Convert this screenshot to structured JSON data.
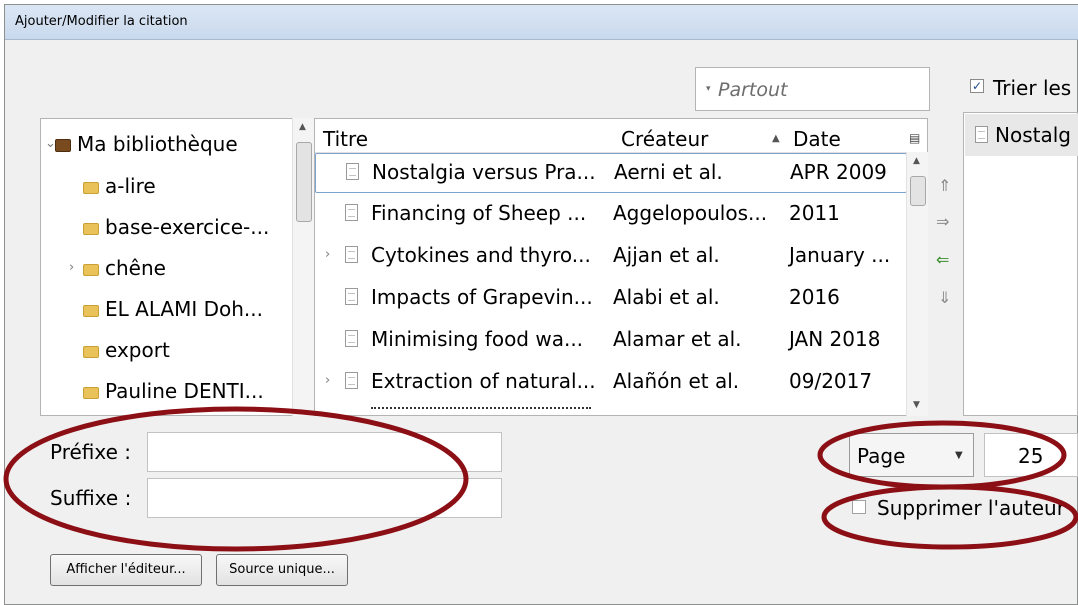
{
  "window": {
    "title": "Ajouter/Modifier la citation"
  },
  "search": {
    "placeholder": "Partout"
  },
  "sort": {
    "label": "Trier les",
    "checked": true,
    "check_glyph": "✓"
  },
  "collections": {
    "items": [
      {
        "label": "Ma bibliothèque",
        "expander": "⌄",
        "icon": "library-icon"
      },
      {
        "label": "a-lire",
        "icon": "folder-icon"
      },
      {
        "label": "base-exercice-...",
        "icon": "folder-icon"
      },
      {
        "label": "chêne",
        "expander": "›",
        "icon": "folder-icon"
      },
      {
        "label": "EL ALAMI Doh...",
        "icon": "folder-icon"
      },
      {
        "label": "export",
        "icon": "folder-icon"
      },
      {
        "label": "Pauline DENTI...",
        "icon": "folder-icon"
      }
    ]
  },
  "items_table": {
    "headers": {
      "title": "Titre",
      "creator": "Créateur",
      "date": "Date"
    },
    "rows": [
      {
        "title": "Nostalgia versus Pra...",
        "creator": "Aerni et al.",
        "date": "APR 2009"
      },
      {
        "title": "Financing of Sheep ...",
        "creator": "Aggelopoulos...",
        "date": "2011"
      },
      {
        "title": "Cytokines and thyro...",
        "creator": "Ajjan et al.",
        "date": "January ...",
        "expander": "›"
      },
      {
        "title": "Impacts of Grapevin...",
        "creator": "Alabi et al.",
        "date": "2016"
      },
      {
        "title": "Minimising food wa...",
        "creator": "Alamar et al.",
        "date": "JAN 2018"
      },
      {
        "title": "Extraction of natural...",
        "creator": "Alañón et al.",
        "date": "09/2017",
        "expander": "›"
      }
    ]
  },
  "move_arrows": {
    "up": "⇑",
    "right": "⇒",
    "left": "⇐",
    "down": "⇓"
  },
  "cited": {
    "item": "Nostalg"
  },
  "fields": {
    "prefix_label": "Préfixe :",
    "suffix_label": "Suffixe :",
    "prefix_value": "",
    "suffix_value": ""
  },
  "locator": {
    "type": "Page",
    "value": "25"
  },
  "suppress": {
    "label": "Supprimer l'auteur",
    "checked": false
  },
  "buttons": {
    "show_editor": "Afficher l'éditeur...",
    "single_source": "Source unique..."
  },
  "colors": {
    "annotation": "#8b0f14",
    "selected_row_border": "#7da2ce",
    "accent_arrow": "#3a8f2c"
  }
}
